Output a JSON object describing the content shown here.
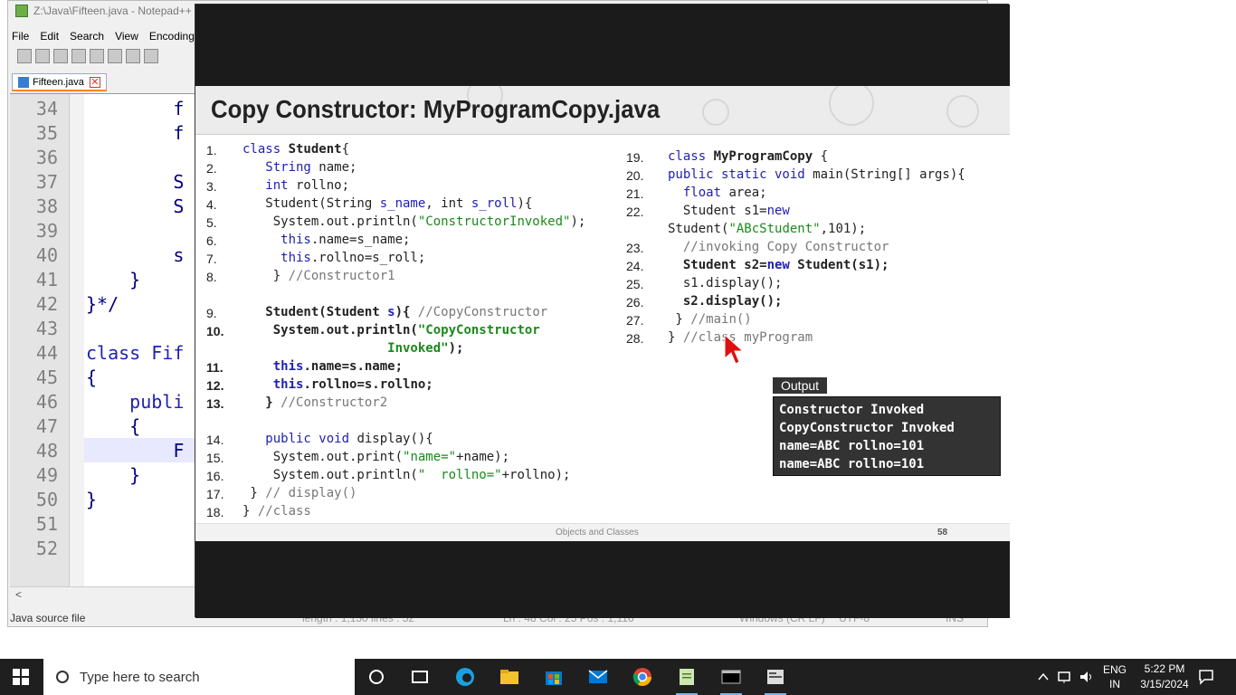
{
  "notepad": {
    "title": "Z:\\Java\\Fifteen.java - Notepad++",
    "menu": [
      "File",
      "Edit",
      "Search",
      "View",
      "Encoding"
    ],
    "tab_label": "Fifteen.java",
    "close_tab_glyph": "✕",
    "lines": [
      {
        "n": "34",
        "text": "        f"
      },
      {
        "n": "35",
        "text": "        f"
      },
      {
        "n": "36",
        "text": ""
      },
      {
        "n": "37",
        "text": "        S"
      },
      {
        "n": "38",
        "text": "        S"
      },
      {
        "n": "39",
        "text": ""
      },
      {
        "n": "40",
        "text": "        s"
      },
      {
        "n": "41",
        "text": "    }"
      },
      {
        "n": "42",
        "text": "}*/"
      },
      {
        "n": "43",
        "text": ""
      },
      {
        "n": "44",
        "text": "class Fif"
      },
      {
        "n": "45",
        "text": "{"
      },
      {
        "n": "46",
        "text": "    publi"
      },
      {
        "n": "47",
        "text": "    {"
      },
      {
        "n": "48",
        "text": "        F"
      },
      {
        "n": "49",
        "text": "    }"
      },
      {
        "n": "50",
        "text": "}"
      },
      {
        "n": "51",
        "text": ""
      },
      {
        "n": "52",
        "text": ""
      }
    ],
    "status": {
      "file_type": "Java source file",
      "length": "length : 1,130    lines : 52",
      "position": "Ln : 48    Col : 25    Pos : 1,116",
      "eol": "Windows (CR LF)",
      "encoding": "UTF-8",
      "mode": "INS"
    },
    "scroll_left_glyph": "<"
  },
  "slide": {
    "title": "Copy Constructor: MyProgramCopy.java",
    "footer_text": "Objects and Classes",
    "page_number": "58",
    "left_code": [
      {
        "n": "1.",
        "parts": [
          {
            "t": "class ",
            "c": "kw"
          },
          {
            "t": "Student",
            "c": "b"
          },
          {
            "t": "{",
            "c": ""
          }
        ]
      },
      {
        "n": "2.",
        "parts": [
          {
            "t": "   String",
            "c": "kw"
          },
          {
            "t": " name;",
            "c": ""
          }
        ]
      },
      {
        "n": "3.",
        "parts": [
          {
            "t": "   int",
            "c": "kw"
          },
          {
            "t": " rollno;",
            "c": ""
          }
        ]
      },
      {
        "n": "4.",
        "parts": [
          {
            "t": "   Student(String ",
            "c": ""
          },
          {
            "t": "s_name",
            "c": "kw"
          },
          {
            "t": ", int ",
            "c": ""
          },
          {
            "t": "s_roll",
            "c": "kw"
          },
          {
            "t": "){",
            "c": ""
          }
        ]
      },
      {
        "n": "5.",
        "parts": [
          {
            "t": "    System.out.println(",
            "c": ""
          },
          {
            "t": "\"ConstructorInvoked\"",
            "c": "str"
          },
          {
            "t": ");",
            "c": ""
          }
        ]
      },
      {
        "n": "6.",
        "parts": [
          {
            "t": "     this",
            "c": "kw"
          },
          {
            "t": ".name=s_name;",
            "c": ""
          }
        ]
      },
      {
        "n": "7.",
        "parts": [
          {
            "t": "     this",
            "c": "kw"
          },
          {
            "t": ".rollno=s_roll;",
            "c": ""
          }
        ]
      },
      {
        "n": "8.",
        "parts": [
          {
            "t": "    } ",
            "c": ""
          },
          {
            "t": "//Constructor1",
            "c": "cm"
          }
        ]
      },
      {
        "n": "9.",
        "parts": [
          {
            "t": "   Student(Student ",
            "c": "b"
          },
          {
            "t": "s",
            "c": "kw b"
          },
          {
            "t": "){ ",
            "c": "b"
          },
          {
            "t": "//CopyConstructor",
            "c": "cm"
          }
        ]
      },
      {
        "n": "10.",
        "parts": [
          {
            "t": "    System.out.println(",
            "c": "b"
          },
          {
            "t": "\"CopyConstructor",
            "c": "str b"
          }
        ]
      },
      {
        "n": "",
        "parts": [
          {
            "t": "                   Invoked\"",
            "c": "str b"
          },
          {
            "t": ");",
            "c": "b"
          }
        ]
      },
      {
        "n": "11.",
        "parts": [
          {
            "t": "    this",
            "c": "kw b"
          },
          {
            "t": ".name=s.name;",
            "c": "b"
          }
        ]
      },
      {
        "n": "12.",
        "parts": [
          {
            "t": "    this",
            "c": "kw b"
          },
          {
            "t": ".rollno=s.rollno;",
            "c": "b"
          }
        ]
      },
      {
        "n": "13.",
        "parts": [
          {
            "t": "   } ",
            "c": "b"
          },
          {
            "t": "//Constructor2",
            "c": "cm"
          }
        ]
      },
      {
        "n": "14.",
        "parts": [
          {
            "t": "   public void",
            "c": "kw"
          },
          {
            "t": " display(){",
            "c": ""
          }
        ]
      },
      {
        "n": "15.",
        "parts": [
          {
            "t": "    System.out.print(",
            "c": ""
          },
          {
            "t": "\"name=\"",
            "c": "str"
          },
          {
            "t": "+name);",
            "c": ""
          }
        ]
      },
      {
        "n": "16.",
        "parts": [
          {
            "t": "    System.out.println(",
            "c": ""
          },
          {
            "t": "\"  rollno=\"",
            "c": "str"
          },
          {
            "t": "+rollno);",
            "c": ""
          }
        ]
      },
      {
        "n": "17.",
        "parts": [
          {
            "t": " } ",
            "c": ""
          },
          {
            "t": "// display()",
            "c": "cm"
          }
        ]
      },
      {
        "n": "18.",
        "parts": [
          {
            "t": "} ",
            "c": ""
          },
          {
            "t": "//class",
            "c": "cm"
          }
        ]
      }
    ],
    "right_code": [
      {
        "n": "19.",
        "parts": [
          {
            "t": "class ",
            "c": "kw"
          },
          {
            "t": "MyProgramCopy",
            "c": "b"
          },
          {
            "t": " {",
            "c": ""
          }
        ]
      },
      {
        "n": "20.",
        "parts": [
          {
            "t": "public static void",
            "c": "kw"
          },
          {
            "t": " main(String[] args){",
            "c": ""
          }
        ]
      },
      {
        "n": "21.",
        "parts": [
          {
            "t": "  float",
            "c": "kw"
          },
          {
            "t": " area;",
            "c": ""
          }
        ]
      },
      {
        "n": "22.",
        "parts": [
          {
            "t": "  Student s1=",
            "c": ""
          },
          {
            "t": "new",
            "c": "kw"
          }
        ]
      },
      {
        "n": "",
        "parts": [
          {
            "t": "Student(",
            "c": ""
          },
          {
            "t": "\"ABcStudent\"",
            "c": "str"
          },
          {
            "t": ",101);",
            "c": ""
          }
        ]
      },
      {
        "n": "23.",
        "parts": [
          {
            "t": "  //invoking Copy Constructor",
            "c": "cm"
          }
        ]
      },
      {
        "n": "24.",
        "parts": [
          {
            "t": "  Student s2=",
            "c": "b"
          },
          {
            "t": "new",
            "c": "kw b"
          },
          {
            "t": " Student(s1);",
            "c": "b"
          }
        ]
      },
      {
        "n": "25.",
        "parts": [
          {
            "t": "  s1.display();",
            "c": ""
          }
        ]
      },
      {
        "n": "26.",
        "parts": [
          {
            "t": "  s2.display();",
            "c": "b"
          }
        ]
      },
      {
        "n": "27.",
        "parts": [
          {
            "t": " } ",
            "c": ""
          },
          {
            "t": "//main()",
            "c": "cm"
          }
        ]
      },
      {
        "n": "28.",
        "parts": [
          {
            "t": "} ",
            "c": ""
          },
          {
            "t": "//class myProgram",
            "c": "cm"
          }
        ]
      }
    ],
    "output_label": "Output",
    "output_lines": [
      "Constructor Invoked",
      "CopyConstructor Invoked",
      "name=ABC  rollno=101",
      "name=ABC  rollno=101"
    ]
  },
  "taskbar": {
    "search_placeholder": "Type here to search",
    "language": "ENG",
    "region": "IN",
    "time": "5:22 PM",
    "date": "3/15/2024"
  },
  "colors": {
    "keyword": "#1f1fb4",
    "string": "#1a8a1a",
    "comment": "#777777",
    "taskbar": "#1f1f1f"
  }
}
